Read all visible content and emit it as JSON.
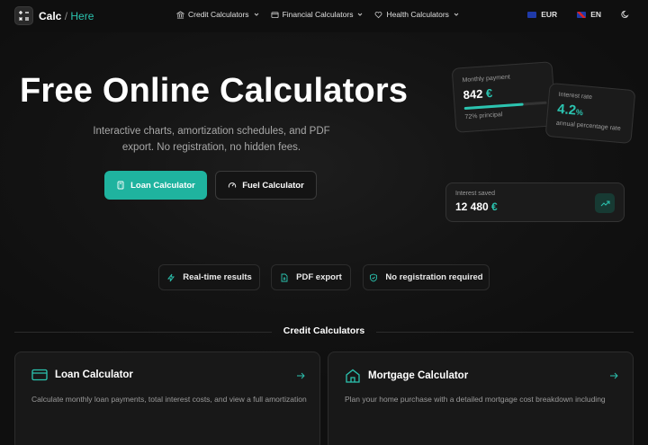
{
  "brand": {
    "name": "Calc",
    "separator": " / ",
    "suffix": "Here"
  },
  "nav": {
    "items": [
      {
        "label": "Credit Calculators"
      },
      {
        "label": "Financial Calculators"
      },
      {
        "label": "Health Calculators"
      }
    ],
    "currency": "EUR",
    "language": "EN"
  },
  "hero": {
    "title": "Free Online Calculators",
    "subtitle": "Interactive charts, amortization schedules, and PDF export. No registration, no hidden fees.",
    "primary_button": "Loan Calculator",
    "secondary_button": "Fuel Calculator"
  },
  "cards": {
    "monthly": {
      "label": "Monthly payment",
      "value": "842",
      "currency": "€",
      "note": "72% principal",
      "progress": 0.72
    },
    "interest": {
      "label": "Interest rate",
      "value": "4.2",
      "unit": "%",
      "note": "annual percentage rate"
    },
    "saved": {
      "label": "Interest saved",
      "value": "12 480",
      "currency": "€"
    }
  },
  "features": [
    {
      "label": "Real-time results"
    },
    {
      "label": "PDF export"
    },
    {
      "label": "No registration required"
    }
  ],
  "section": {
    "title": "Credit Calculators",
    "calculators": [
      {
        "title": "Loan Calculator",
        "description": "Calculate monthly loan payments, total interest costs, and view a full amortization"
      },
      {
        "title": "Mortgage Calculator",
        "description": "Plan your home purchase with a detailed mortgage cost breakdown including"
      }
    ]
  },
  "colors": {
    "accent": "#1fb39f",
    "background": "#0f0f0f"
  }
}
